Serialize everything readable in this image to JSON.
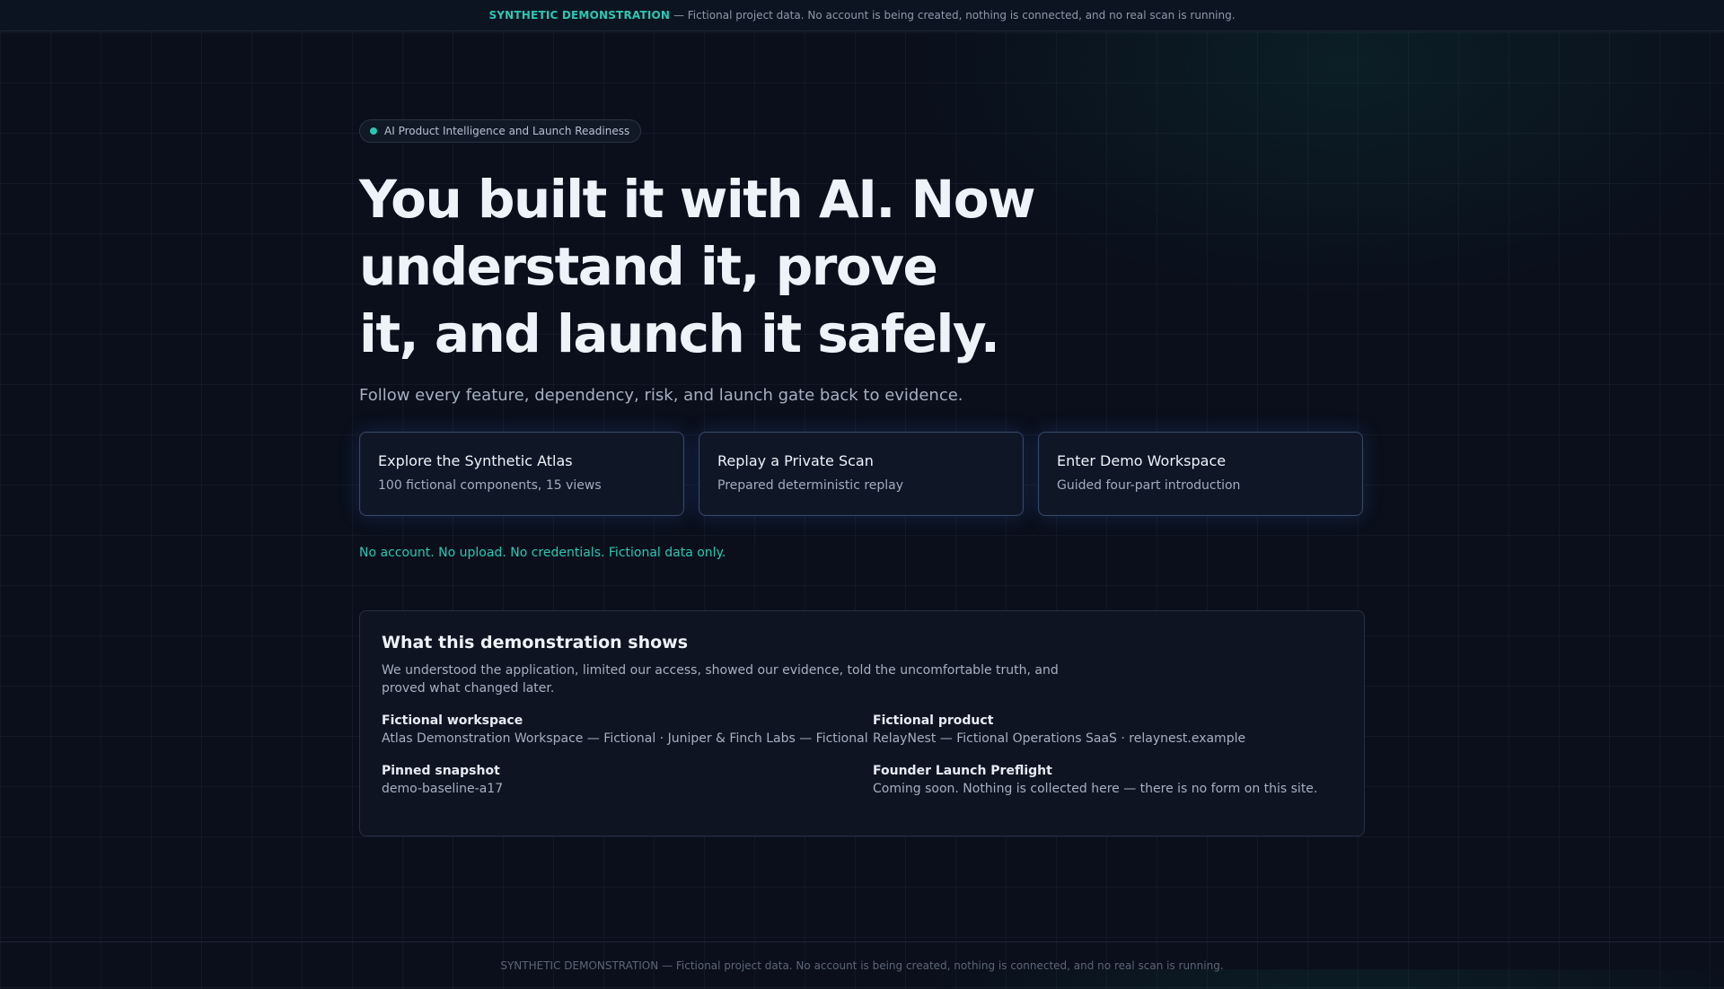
{
  "banner": {
    "tag": "SYNTHETIC DEMONSTRATION",
    "text": " — Fictional project data. No account is being created, nothing is connected, and no real scan is running."
  },
  "hero": {
    "pill": "AI Product Intelligence and Launch Readiness",
    "title_lines": [
      "You built it with AI. Now",
      "understand it, prove",
      "it, and launch it safely."
    ],
    "subtitle": "Follow every feature, dependency, risk, and launch gate back to evidence."
  },
  "actions": [
    {
      "title": "Explore the Synthetic Atlas",
      "subtitle": "100 fictional components, 15 views"
    },
    {
      "title": "Replay a Private Scan",
      "subtitle": "Prepared deterministic replay"
    },
    {
      "title": "Enter Demo Workspace",
      "subtitle": "Guided four-part introduction"
    }
  ],
  "note": "No account. No upload. No credentials. Fictional data only.",
  "panel": {
    "title": "What this demonstration shows",
    "description": "We understood the application, limited our access, showed our evidence, told the uncomfortable truth, and proved what changed later.",
    "fields": [
      {
        "label": "Fictional workspace",
        "value": "Atlas Demonstration Workspace — Fictional · Juniper & Finch Labs — Fictional"
      },
      {
        "label": "Fictional product",
        "value": "RelayNest — Fictional Operations SaaS · relaynest.example"
      },
      {
        "label": "Pinned snapshot",
        "value": "demo-baseline-a17"
      },
      {
        "label": "Founder Launch Preflight",
        "value": "Coming soon. Nothing is collected here — there is no form on this site."
      }
    ]
  },
  "footer": {
    "tag": "SYNTHETIC DEMONSTRATION",
    "text": " — Fictional project data. No account is being created, nothing is connected, and no real scan is running."
  },
  "colors": {
    "accent": "#2cc7b3",
    "background": "#0a0f1b",
    "card_border": "#364766"
  }
}
